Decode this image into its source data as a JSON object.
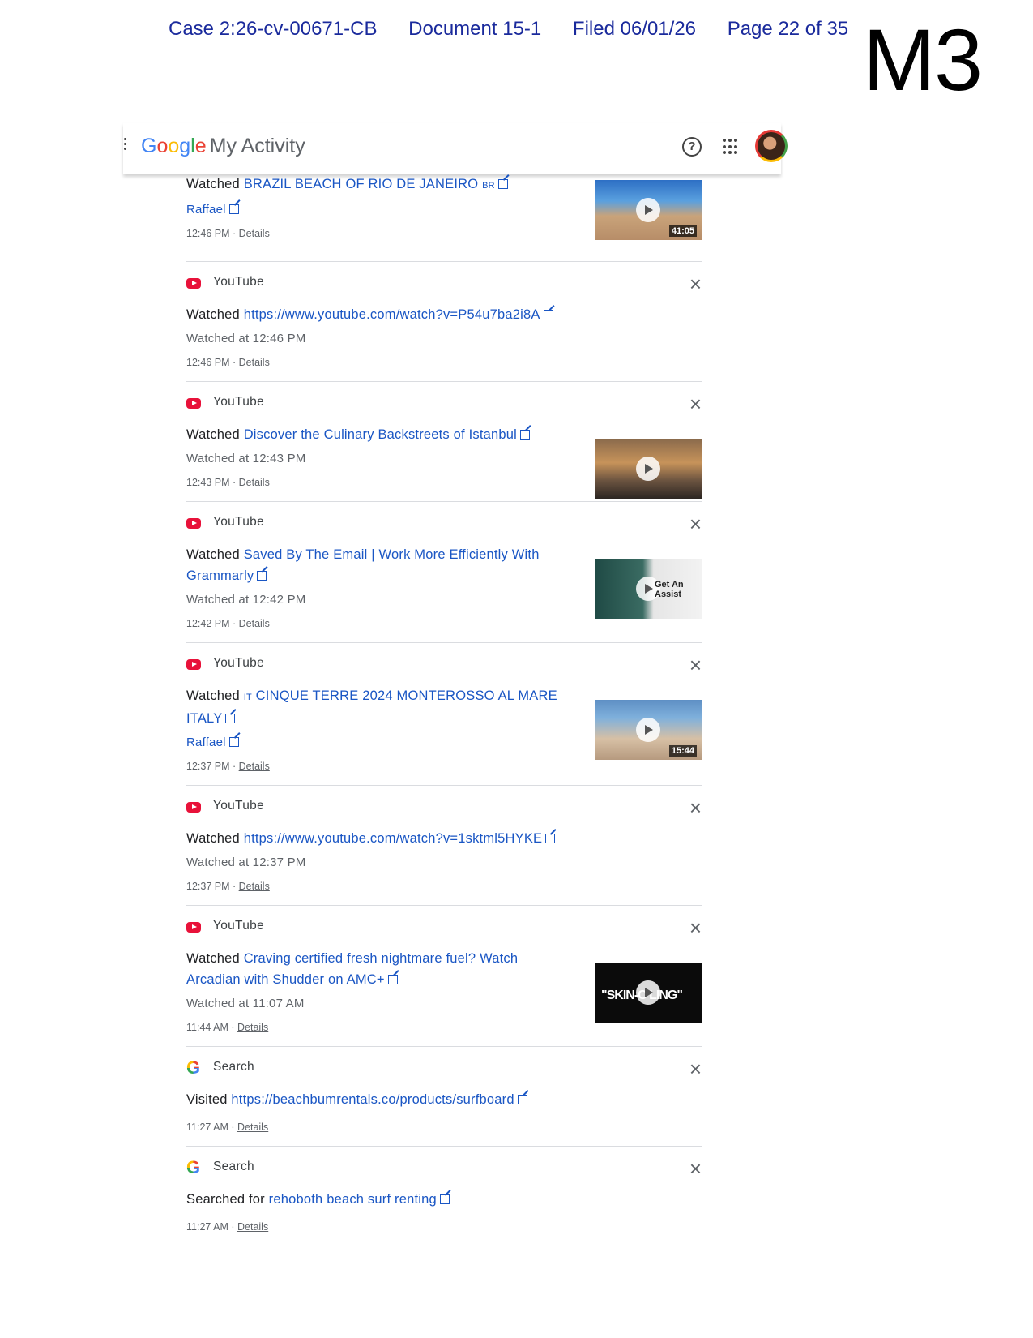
{
  "stamp": {
    "case": "Case 2:26-cv-00671-CB",
    "document": "Document 15-1",
    "filed": "Filed 06/01/26",
    "page": "Page 22 of 35",
    "exhibit": "M3"
  },
  "topbar": {
    "logo_letters": [
      "G",
      "o",
      "o",
      "g",
      "l",
      "e"
    ],
    "title": "My Activity",
    "help_glyph": "?"
  },
  "items": [
    {
      "verb": "Watched ",
      "title": "BRAZIL BEACH OF RIO DE JANEIRO",
      "title_suffix": "BR",
      "sub": "Raffael",
      "sub_is_link": true,
      "time": "12:46 PM",
      "details": "Details",
      "thumb_duration": "41:05"
    },
    {
      "product": "YouTube",
      "verb": "Watched ",
      "title": "https://www.youtube.com/watch?v=P54u7ba2i8A",
      "sub": "Watched at 12:46 PM",
      "time": "12:46 PM",
      "details": "Details"
    },
    {
      "product": "YouTube",
      "verb": "Watched ",
      "title": "Discover the Culinary Backstreets of Istanbul",
      "sub": "Watched at 12:43 PM",
      "time": "12:43 PM",
      "details": "Details"
    },
    {
      "product": "YouTube",
      "verb": "Watched ",
      "title": "Saved By The Email | Work More Efficiently With Grammarly",
      "sub": "Watched at 12:42 PM",
      "time": "12:42 PM",
      "details": "Details",
      "thumb_text": "Get An Assist"
    },
    {
      "product": "YouTube",
      "verb": "Watched ",
      "title_prefix": "IT",
      "title": "CINQUE TERRE 2024 MONTEROSSO AL MARE ITALY",
      "sub": "Raffael",
      "sub_is_link": true,
      "time": "12:37 PM",
      "details": "Details",
      "thumb_duration": "15:44"
    },
    {
      "product": "YouTube",
      "verb": "Watched ",
      "title": "https://www.youtube.com/watch?v=1sktml5HYKE",
      "sub": "Watched at 12:37 PM",
      "time": "12:37 PM",
      "details": "Details"
    },
    {
      "product": "YouTube",
      "verb": "Watched ",
      "title": "Craving certified fresh nightmare fuel? Watch Arcadian with Shudder on AMC+",
      "sub": "Watched at 11:07 AM",
      "time": "11:44 AM",
      "details": "Details",
      "thumb_text": "\"SKIN-C   LING\""
    },
    {
      "product": "Search",
      "verb": "Visited ",
      "title": "https://beachbumrentals.co/products/surfboard",
      "time": "11:27 AM",
      "details": "Details"
    },
    {
      "product": "Search",
      "verb": "Searched for ",
      "title": "rehoboth beach surf renting",
      "time": "11:27 AM",
      "details": "Details"
    }
  ],
  "icons": {
    "product_youtube": "youtube-logo-icon",
    "product_search": "google-g-icon",
    "close": "close-icon",
    "external": "external-link-icon"
  },
  "colors": {
    "stamp": "#1a2a9c",
    "link": "#1a56c4",
    "youtube_red": "#e8123a"
  }
}
